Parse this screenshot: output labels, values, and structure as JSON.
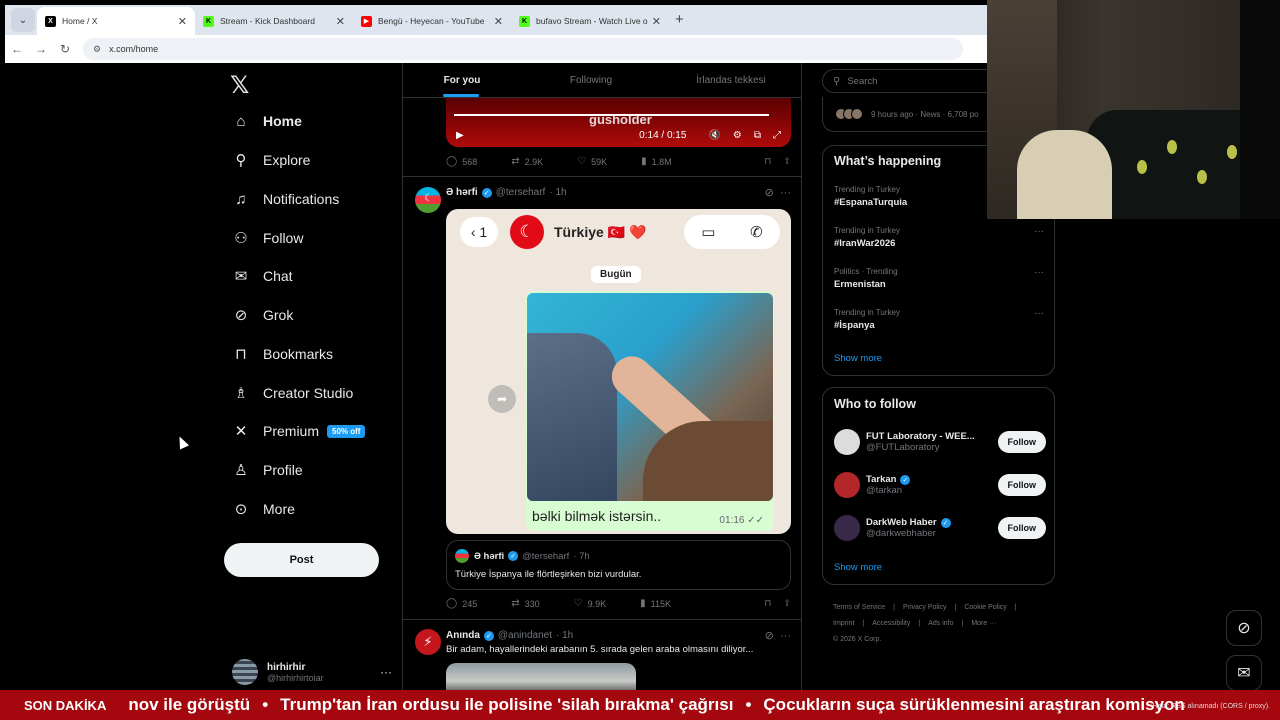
{
  "browser": {
    "tabs": [
      {
        "title": "Home / X",
        "active": true,
        "favicon": "x-logo",
        "favicon_color": "#000000"
      },
      {
        "title": "Stream - Kick Dashboard",
        "active": false,
        "favicon": "kick-logo",
        "favicon_color": "#53fc18"
      },
      {
        "title": "Bengü - Heyecan - YouTube",
        "active": false,
        "favicon": "youtube-logo",
        "favicon_color": "#ff0000"
      },
      {
        "title": "bufavo Stream - Watch Live on",
        "active": false,
        "favicon": "kick-logo",
        "favicon_color": "#53fc18"
      }
    ],
    "url": "x.com/home"
  },
  "nav": {
    "items": [
      {
        "label": "Home",
        "icon": "home-icon"
      },
      {
        "label": "Explore",
        "icon": "search-icon"
      },
      {
        "label": "Notifications",
        "icon": "bell-icon"
      },
      {
        "label": "Follow",
        "icon": "add-person-icon"
      },
      {
        "label": "Chat",
        "icon": "envelope-icon"
      },
      {
        "label": "Grok",
        "icon": "grok-icon"
      },
      {
        "label": "Bookmarks",
        "icon": "bookmark-icon"
      },
      {
        "label": "Creator Studio",
        "icon": "creator-icon"
      },
      {
        "label": "Premium",
        "icon": "x-icon",
        "badge": "50% off"
      },
      {
        "label": "Profile",
        "icon": "person-icon"
      },
      {
        "label": "More",
        "icon": "more-circle-icon"
      }
    ],
    "post_label": "Post",
    "account": {
      "name": "hirhirhir",
      "handle": "@hirhirhirtoiar"
    }
  },
  "timeline": {
    "tabs": [
      "For you",
      "Following",
      "İrlandas tekkesi"
    ],
    "video": {
      "brand": "gusholder",
      "time": "0:14 / 0:15"
    },
    "tweet1_stats": {
      "replies": "568",
      "reposts": "2.9K",
      "likes": "59K",
      "views": "1.8M"
    },
    "tweet2": {
      "name": "Ə hərfi",
      "handle": "@terseharf",
      "time": "· 1h",
      "wa_contact": "Türkiye 🇹🇷 ❤️",
      "wa_back": "1",
      "wa_day": "Bugün",
      "wa_message": "bəlki bilmək istərsin..",
      "wa_time": "01:16",
      "quote": {
        "name": "Ə hərfi",
        "handle": "@terseharf",
        "time": "· 7h",
        "text": "Türkiye İspanya ile flörtleşirken bizi vurdular."
      },
      "stats": {
        "replies": "245",
        "reposts": "330",
        "likes": "9.9K",
        "views": "115K"
      }
    },
    "tweet3": {
      "name": "Anında",
      "handle": "@anindanet",
      "time": "· 1h",
      "text": "Bir adam, hayallerindeki arabanın 5. sırada gelen araba olmasını diliyor..."
    }
  },
  "right": {
    "search_placeholder": "Search",
    "news_meta": "9 hours ago · News · 6,708 po",
    "happening_title": "What’s happening",
    "trends": [
      {
        "meta": "Trending in Turkey",
        "name": "#EspanaTurquia"
      },
      {
        "meta": "Trending in Turkey",
        "name": "#IranWar2026"
      },
      {
        "meta": "Politics · Trending",
        "name": "Ermenistan"
      },
      {
        "meta": "Trending in Turkey",
        "name": "#İspanya"
      }
    ],
    "show_more": "Show more",
    "who_title": "Who to follow",
    "who": [
      {
        "name": "FUT Laboratory - WEE...",
        "handle": "@FUTLaboratory",
        "verified": false,
        "follow": "Follow",
        "avatar_color": "#dddddd"
      },
      {
        "name": "Tarkan",
        "handle": "@tarkan",
        "verified": true,
        "follow": "Follow",
        "avatar_color": "#b3262a"
      },
      {
        "name": "DarkWeb Haber",
        "handle": "@darkwebhaber",
        "verified": true,
        "follow": "Follow",
        "avatar_color": "#3a2a4a"
      }
    ],
    "footer": [
      "Terms of Service",
      "|",
      "Privacy Policy",
      "|",
      "Cookie Policy",
      "|",
      "Imprint",
      "|",
      "Accessibility",
      "|",
      "Ads info",
      "|",
      "More ···",
      "© 2026 X Corp."
    ]
  },
  "ticker": {
    "label": "SON DAKİKA",
    "items": [
      "nov ile görüştü",
      "Trump'tan İran ordusu ile polisine 'silah bırakma' çağrısı",
      "Çocukların suça sürüklenmesini araştıran komisyon"
    ],
    "rss_note": "Hata: RSS alınamadı (CORS / proxy)."
  }
}
